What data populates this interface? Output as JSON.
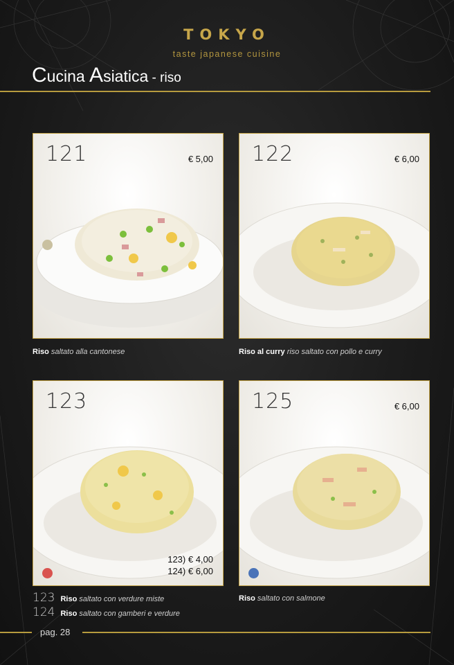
{
  "brand": {
    "name": "TOKYO",
    "tagline": "taste japanese cuisine"
  },
  "header": {
    "title_c": "C",
    "title_ucina": "ucina ",
    "title_a": "A",
    "title_siatica": "siatica",
    "title_suffix": " - riso"
  },
  "dishes": [
    {
      "number": "121",
      "price": "€ 5,00",
      "name": "Riso",
      "description": "saltato alla cantonese",
      "badge_color": "#c9c0a0",
      "badge_icon": "egg-icon"
    },
    {
      "number": "122",
      "price": "€ 6,00",
      "name": "Riso al curry",
      "description": "riso saltato con pollo e curry"
    },
    {
      "number": "123",
      "price_lines": [
        "123) € 4,00",
        "124) € 6,00"
      ],
      "badge_color": "#d9534f",
      "badge_icon": "shrimp-icon"
    },
    {
      "number": "125",
      "price": "€ 6,00",
      "name": "Riso",
      "description": "saltato con salmone",
      "badge_color": "#4a73b8",
      "badge_icon": "fish-icon"
    }
  ],
  "notes": [
    {
      "number": "123",
      "name": "Riso",
      "description": "saltato con verdure miste"
    },
    {
      "number": "124",
      "name": "Riso",
      "description": "saltato con gamberi e verdure"
    }
  ],
  "footer": {
    "page": "pag. 28"
  },
  "colors": {
    "gold": "#c7a64a",
    "background": "#1c1c1c"
  }
}
